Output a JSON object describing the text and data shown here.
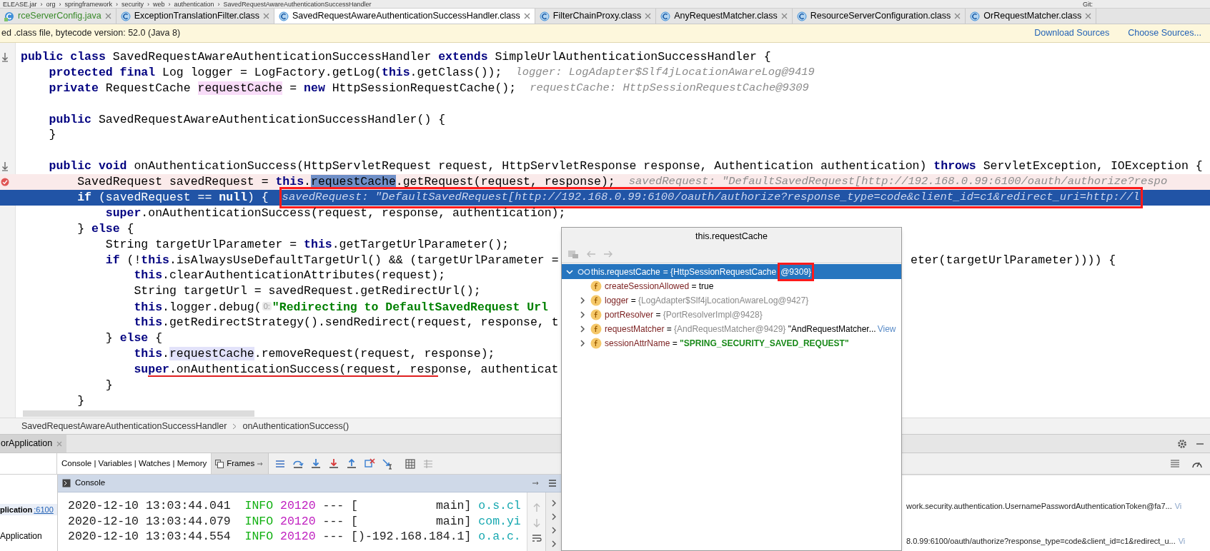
{
  "path_bar": {
    "text": "ELEASE.jar  ›  org  ›  springframework  ›  security  ›  web  ›  authentication  ›  SavedRequestAwareAuthenticationSuccessHandler",
    "vcs": "Git:"
  },
  "tabs": [
    {
      "label": "rceServerConfig.java",
      "kind": "java",
      "selected": false
    },
    {
      "label": "ExceptionTranslationFilter.class",
      "kind": "class",
      "selected": false
    },
    {
      "label": "SavedRequestAwareAuthenticationSuccessHandler.class",
      "kind": "class",
      "selected": true
    },
    {
      "label": "FilterChainProxy.class",
      "kind": "class",
      "selected": false
    },
    {
      "label": "AnyRequestMatcher.class",
      "kind": "class",
      "selected": false
    },
    {
      "label": "ResourceServerConfiguration.class",
      "kind": "class",
      "selected": false
    },
    {
      "label": "OrRequestMatcher.class",
      "kind": "class",
      "selected": false
    }
  ],
  "notice": {
    "text": "ed .class file, bytecode version: 52.0 (Java 8)",
    "actions": [
      "Download Sources",
      "Choose Sources..."
    ]
  },
  "editor": {
    "lines": [
      {
        "kind": "override",
        "segments": [
          {
            "kind": "keyword",
            "t": "public class"
          },
          {
            "kind": "code",
            "t": " SavedRequestAwareAuthenticationSuccessHandler "
          },
          {
            "kind": "keyword",
            "t": "extends"
          },
          {
            "kind": "code",
            "t": " SimpleUrlAuthenticationSuccessHandler {"
          }
        ]
      },
      {
        "kind": "plain",
        "segments": [
          {
            "kind": "keyword",
            "t": "    protected final"
          },
          {
            "kind": "code",
            "t": " Log logger = LogFactory.getLog("
          },
          {
            "kind": "keyword",
            "t": "this"
          },
          {
            "kind": "code",
            "t": ".getClass());"
          }
        ],
        "hint": "logger: LogAdapter$Slf4jLocationAwareLog@9419"
      },
      {
        "kind": "plain",
        "segments": [
          {
            "kind": "keyword",
            "t": "    private"
          },
          {
            "kind": "code",
            "t": " RequestCache "
          },
          {
            "kind": "write",
            "t": "requestCache"
          },
          {
            "kind": "code",
            "t": " = "
          },
          {
            "kind": "keyword",
            "t": "new"
          },
          {
            "kind": "code",
            "t": " HttpSessionRequestCache();"
          }
        ],
        "hint": "requestCache: HttpSessionRequestCache@9309"
      },
      {
        "kind": "plain"
      },
      {
        "kind": "plain",
        "segments": [
          {
            "kind": "keyword",
            "t": "    public"
          },
          {
            "kind": "code",
            "t": " SavedRequestAwareAuthenticationSuccessHandler() {"
          }
        ]
      },
      {
        "kind": "plain",
        "segments": [
          {
            "kind": "code",
            "t": "    }"
          }
        ]
      },
      {
        "kind": "plain"
      },
      {
        "kind": "override",
        "segments": [
          {
            "kind": "keyword",
            "t": "    public void"
          },
          {
            "kind": "code",
            "t": " onAuthenticationSuccess(HttpServletRequest request, HttpServletResponse response, Authentication authentication) "
          },
          {
            "kind": "keyword",
            "t": "throws"
          },
          {
            "kind": "code",
            "t": " ServletException, IOException {"
          }
        ]
      },
      {
        "kind": "breakpoint",
        "segments": [
          {
            "kind": "code",
            "t": "        SavedRequest savedRequest = "
          },
          {
            "kind": "keyword",
            "t": "this"
          },
          {
            "kind": "code",
            "t": "."
          },
          {
            "kind": "selection",
            "t": "requestCache"
          },
          {
            "kind": "code",
            "t": ".getRequest(request, response);"
          }
        ],
        "hint": "savedRequest: \"DefaultSavedRequest[http://192.168.0.99:6100/oauth/authorize?respo"
      },
      {
        "kind": "execution",
        "segments": [
          {
            "kind": "keyword",
            "t": "        if"
          },
          {
            "kind": "code",
            "t": " (savedRequest == "
          },
          {
            "kind": "keyword",
            "t": "null"
          },
          {
            "kind": "code",
            "t": ") {"
          }
        ],
        "hint": "savedRequest: \"DefaultSavedRequest[http://192.168.0.99:6100/oauth/authorize?response_type=code&client_id=c1&redirect_uri=http://l",
        "boxed": true
      },
      {
        "kind": "plain",
        "segments": [
          {
            "kind": "keyword",
            "t": "            super"
          },
          {
            "kind": "code",
            "t": ".onAuthenticationSuccess(request, response, authentication);"
          }
        ]
      },
      {
        "kind": "plain",
        "segments": [
          {
            "kind": "code",
            "t": "        } "
          },
          {
            "kind": "keyword",
            "t": "else"
          },
          {
            "kind": "code",
            "t": " {"
          }
        ]
      },
      {
        "kind": "plain",
        "segments": [
          {
            "kind": "code",
            "t": "            String targetUrlParameter = "
          },
          {
            "kind": "keyword",
            "t": "this"
          },
          {
            "kind": "code",
            "t": ".getTargetUrlParameter();"
          }
        ]
      },
      {
        "kind": "plain",
        "segments": [
          {
            "kind": "keyword",
            "t": "            if"
          },
          {
            "kind": "code",
            "t": " (!"
          },
          {
            "kind": "keyword",
            "t": "this"
          },
          {
            "kind": "code",
            "t": ".isAlwaysUseDefaultTargetUrl() && (targetUrlParameter ="
          }
        ],
        "tail": "eter(targetUrlParameter)))) {"
      },
      {
        "kind": "plain",
        "segments": [
          {
            "kind": "keyword",
            "t": "                this"
          },
          {
            "kind": "code",
            "t": ".clearAuthenticationAttributes(request);"
          }
        ]
      },
      {
        "kind": "plain",
        "segments": [
          {
            "kind": "code",
            "t": "                String targetUrl = savedRequest.getRedirectUrl();"
          }
        ]
      },
      {
        "kind": "plain",
        "segments": [
          {
            "kind": "keyword",
            "t": "                this"
          },
          {
            "kind": "code",
            "t": ".logger.debug("
          },
          {
            "kind": "inlay",
            "t": "0:"
          },
          {
            "kind": "string",
            "t": "\"Redirecting to DefaultSavedRequest Url"
          }
        ]
      },
      {
        "kind": "plain",
        "segments": [
          {
            "kind": "keyword",
            "t": "                this"
          },
          {
            "kind": "code",
            "t": ".getRedirectStrategy().sendRedirect(request, response, t"
          }
        ]
      },
      {
        "kind": "plain",
        "segments": [
          {
            "kind": "code",
            "t": "            } "
          },
          {
            "kind": "keyword",
            "t": "else"
          },
          {
            "kind": "code",
            "t": " {"
          }
        ]
      },
      {
        "kind": "plain",
        "segments": [
          {
            "kind": "keyword",
            "t": "                this"
          },
          {
            "kind": "code",
            "t": "."
          },
          {
            "kind": "read",
            "t": "requestCache"
          },
          {
            "kind": "code",
            "t": ".removeRequest(request, response);"
          }
        ]
      },
      {
        "kind": "plain",
        "underlined": true,
        "segments": [
          {
            "kind": "keyword",
            "t": "                super"
          },
          {
            "kind": "code",
            "t": ".onAuthenticationSuccess(request, response, authenticat"
          }
        ]
      },
      {
        "kind": "plain",
        "segments": [
          {
            "kind": "code",
            "t": "            }"
          }
        ]
      },
      {
        "kind": "plain",
        "segments": [
          {
            "kind": "code",
            "t": "        }"
          }
        ]
      }
    ]
  },
  "breadcrumbs": [
    "SavedRequestAwareAuthenticationSuccessHandler",
    "onAuthenticationSuccess()"
  ],
  "debug": {
    "tab": "orApplication",
    "views": "Console | Variables | Watches | Memory",
    "frames": "Frames",
    "left": {
      "app": "plication",
      "port": ":6100",
      "app2": "Application"
    },
    "console": {
      "title": "Console",
      "lines": [
        [
          {
            "kind": "time",
            "t": "2020-12-10 13:03:44.041  "
          },
          {
            "kind": "level",
            "t": "INFO "
          },
          {
            "kind": "pid",
            "t": "20120"
          },
          {
            "kind": "time",
            "t": " --- [           main] "
          },
          {
            "kind": "logger",
            "t": "o.s.cl"
          }
        ],
        [
          {
            "kind": "time",
            "t": "2020-12-10 13:03:44.079  "
          },
          {
            "kind": "level",
            "t": "INFO "
          },
          {
            "kind": "pid",
            "t": "20120"
          },
          {
            "kind": "time",
            "t": " --- [           main] "
          },
          {
            "kind": "logger",
            "t": "com.yi"
          }
        ],
        [
          {
            "kind": "time",
            "t": "2020-12-10 13:03:44.554  "
          },
          {
            "kind": "level",
            "t": "INFO "
          },
          {
            "kind": "pid",
            "t": "20120"
          },
          {
            "kind": "time",
            "t": " --- [)-192.168.184.1] "
          },
          {
            "kind": "logger",
            "t": "o.a.c."
          }
        ]
      ]
    },
    "right": [
      {
        "text": "work.security.authentication.UsernamePasswordAuthenticationToken@fa7...",
        "link": "Vi"
      },
      {
        "text": "8.0.99:6100/oauth/authorize?response_type=code&client_id=c1&redirect_u...",
        "link": "Vi"
      }
    ]
  },
  "popup": {
    "title": "this.requestCache",
    "root": {
      "name": "this.requestCache",
      "value": "= {HttpSessionRequestCache",
      "marked": "@9309}",
      "expanded": true,
      "selected": true
    },
    "children": [
      {
        "name": "createSessionAllowed",
        "value": "= true",
        "kind": "plain",
        "expandable": false
      },
      {
        "name": "logger",
        "value": "= {LogAdapter$Slf4jLocationAwareLog@9427}",
        "kind": "object",
        "expandable": true
      },
      {
        "name": "portResolver",
        "value": "= {PortResolverImpl@9428}",
        "kind": "object",
        "expandable": true
      },
      {
        "name": "requestMatcher",
        "value": "= {AndRequestMatcher@9429}",
        "kind": "object",
        "expandable": true,
        "extra": "\"AndRequestMatcher...",
        "link": "View"
      },
      {
        "name": "sessionAttrName",
        "value": "= \"SPRING_SECURITY_SAVED_REQUEST\"",
        "kind": "string",
        "expandable": true
      }
    ]
  }
}
